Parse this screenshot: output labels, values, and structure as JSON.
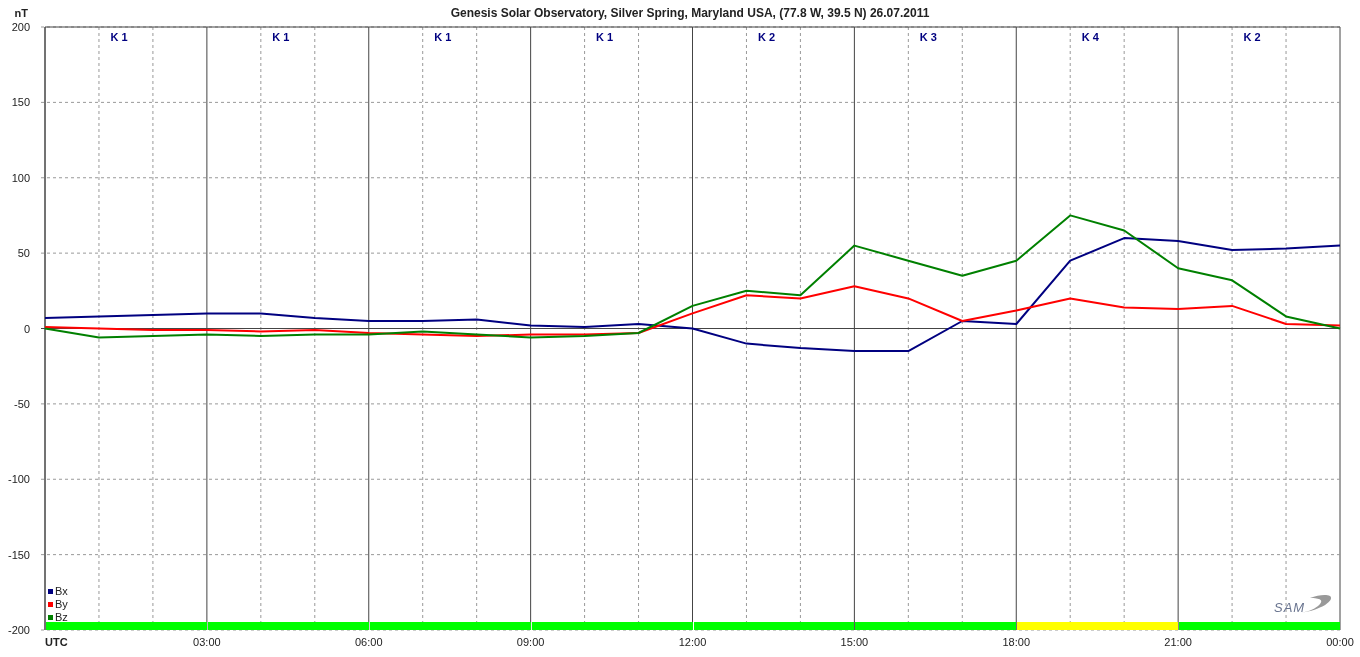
{
  "chart": {
    "chart_data": {
      "type": "line",
      "title": "Genesis Solar Observatory, Silver Spring, Maryland USA, (77.8 W, 39.5 N)  26.07.2011",
      "ylabel": "nT",
      "x": [
        0,
        1,
        2,
        3,
        4,
        5,
        6,
        7,
        8,
        9,
        10,
        11,
        12,
        13,
        14,
        15,
        16,
        17,
        18,
        19,
        20,
        21,
        22,
        23,
        24
      ],
      "xlim": [
        0,
        24
      ],
      "ylim": [
        -200,
        200
      ],
      "xticks": [
        {
          "value": 0,
          "label": "UTC"
        },
        {
          "value": 3,
          "label": "03:00"
        },
        {
          "value": 6,
          "label": "06:00"
        },
        {
          "value": 9,
          "label": "09:00"
        },
        {
          "value": 12,
          "label": "12:00"
        },
        {
          "value": 15,
          "label": "15:00"
        },
        {
          "value": 18,
          "label": "18:00"
        },
        {
          "value": 21,
          "label": "21:00"
        },
        {
          "value": 24,
          "label": "00:00"
        }
      ],
      "yticks": [
        200,
        150,
        100,
        50,
        0,
        -50,
        -100,
        -150,
        -200
      ],
      "grid": true,
      "legend": "lower left",
      "series": [
        {
          "name": "Bx",
          "color": "#000080",
          "values": [
            7,
            8,
            9,
            10,
            10,
            7,
            5,
            5,
            6,
            2,
            1,
            3,
            0,
            -10,
            -13,
            -15,
            -15,
            5,
            3,
            45,
            60,
            58,
            52,
            53,
            55
          ]
        },
        {
          "name": "By",
          "color": "#ff0000",
          "values": [
            1,
            0,
            -1,
            -1,
            -2,
            -1,
            -3,
            -4,
            -5,
            -4,
            -4,
            -3,
            10,
            22,
            20,
            28,
            20,
            5,
            12,
            20,
            14,
            13,
            15,
            3,
            2
          ]
        },
        {
          "name": "Bz",
          "color": "#008000",
          "values": [
            0,
            -6,
            -5,
            -4,
            -5,
            -4,
            -4,
            -2,
            -4,
            -6,
            -5,
            -3,
            15,
            25,
            22,
            55,
            45,
            35,
            45,
            75,
            65,
            40,
            32,
            8,
            0
          ]
        }
      ]
    },
    "k_index": [
      {
        "label": "K 1",
        "color": "#00ff00"
      },
      {
        "label": "K 1",
        "color": "#00ff00"
      },
      {
        "label": "K 1",
        "color": "#00ff00"
      },
      {
        "label": "K 1",
        "color": "#00ff00"
      },
      {
        "label": "K 2",
        "color": "#00ff00"
      },
      {
        "label": "K 3",
        "color": "#00ff00"
      },
      {
        "label": "K 4",
        "color": "#ffff00"
      },
      {
        "label": "K 2",
        "color": "#00ff00"
      }
    ],
    "logo_text": "SAM"
  }
}
